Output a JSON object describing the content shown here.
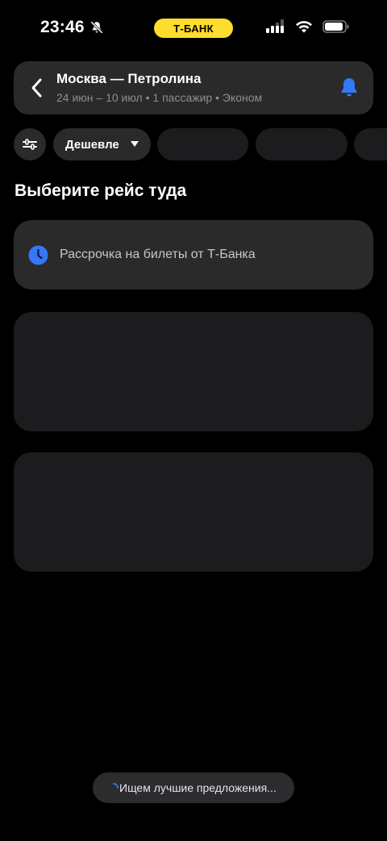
{
  "status_bar": {
    "time": "23:46",
    "brand": "Т-БАНК",
    "icons": [
      "bell-slash-icon",
      "cellular-signal-icon",
      "wifi-icon",
      "battery-icon"
    ]
  },
  "header": {
    "title": "Москва — Петролина",
    "subtitle": "24 июн – 10 июл • 1 пассажир • Эконом",
    "icons": [
      "back-chevron-icon",
      "notification-bell-icon"
    ]
  },
  "filters": {
    "settings_icon": "sliders-icon",
    "sort_label": "Дешевле",
    "sort_icon": "caret-down-icon"
  },
  "section_title": "Выберите рейс туда",
  "promo": {
    "icon": "clock-icon",
    "text": "Рассрочка на билеты от Т-Банка"
  },
  "toast": {
    "icon": "spinner-icon",
    "text": "Ищем лучшие предложения..."
  },
  "colors": {
    "background": "#000000",
    "card": "#2a2a2a",
    "skeleton": "#1c1c1e",
    "brand_yellow": "#ffdd2d",
    "accent_blue": "#3478f6",
    "muted_text": "#8e8e93"
  }
}
